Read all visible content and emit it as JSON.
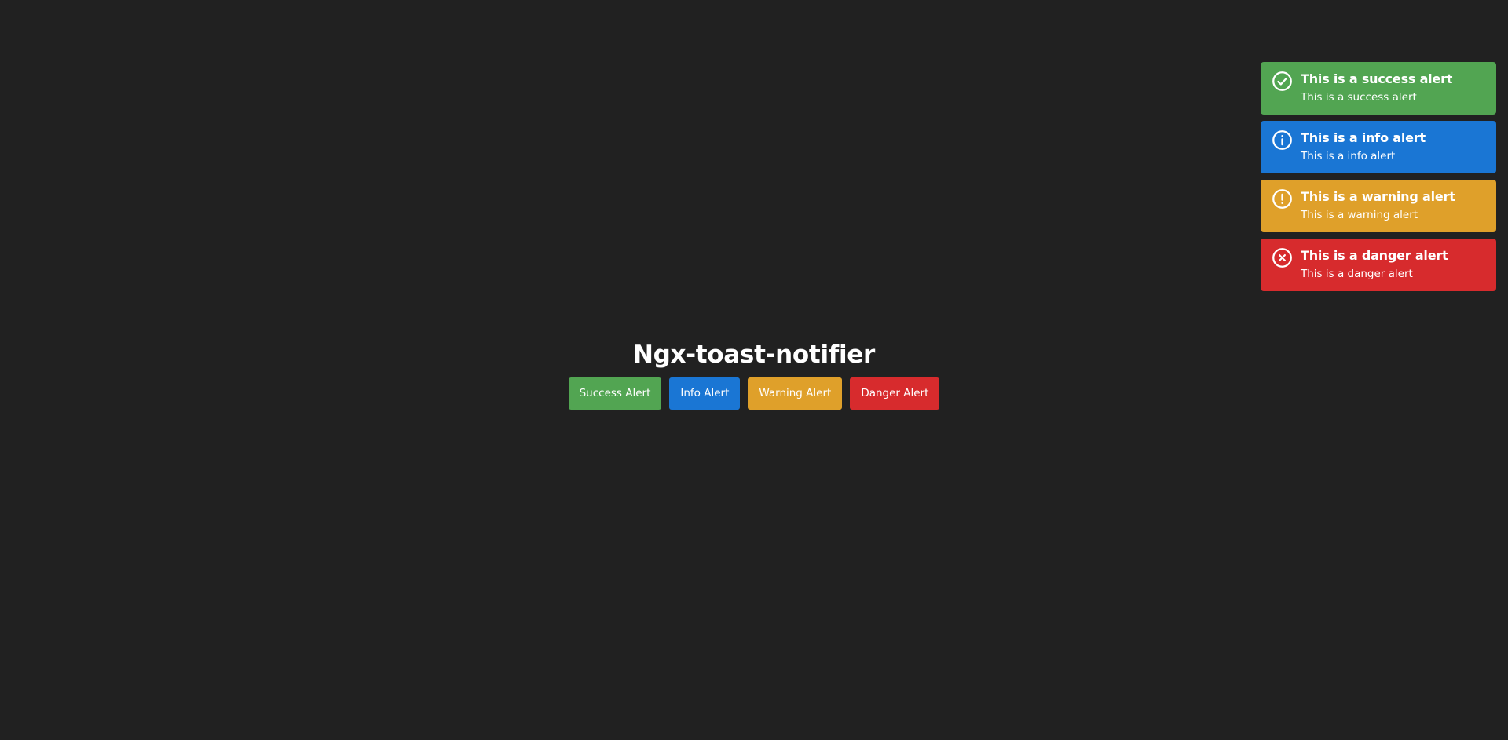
{
  "page": {
    "title": "Ngx-toast-notifier",
    "background_color": "#212121"
  },
  "buttons": [
    {
      "label": "Success Alert",
      "color": "#52a552"
    },
    {
      "label": "Info Alert",
      "color": "#1a76d4"
    },
    {
      "label": "Warning Alert",
      "color": "#dfa02a"
    },
    {
      "label": "Danger Alert",
      "color": "#d72b2d"
    }
  ],
  "toasts": [
    {
      "type": "success",
      "icon": "check-circle-icon",
      "title": "This is a success alert",
      "message": "This is a success alert",
      "color": "#52a552"
    },
    {
      "type": "info",
      "icon": "info-circle-icon",
      "title": "This is a info alert",
      "message": "This is a info alert",
      "color": "#1a76d4"
    },
    {
      "type": "warning",
      "icon": "exclamation-circle-icon",
      "title": "This is a warning alert",
      "message": "This is a warning alert",
      "color": "#dfa02a"
    },
    {
      "type": "danger",
      "icon": "x-circle-icon",
      "title": "This is a danger alert",
      "message": "This is a danger alert",
      "color": "#d72b2d"
    }
  ]
}
